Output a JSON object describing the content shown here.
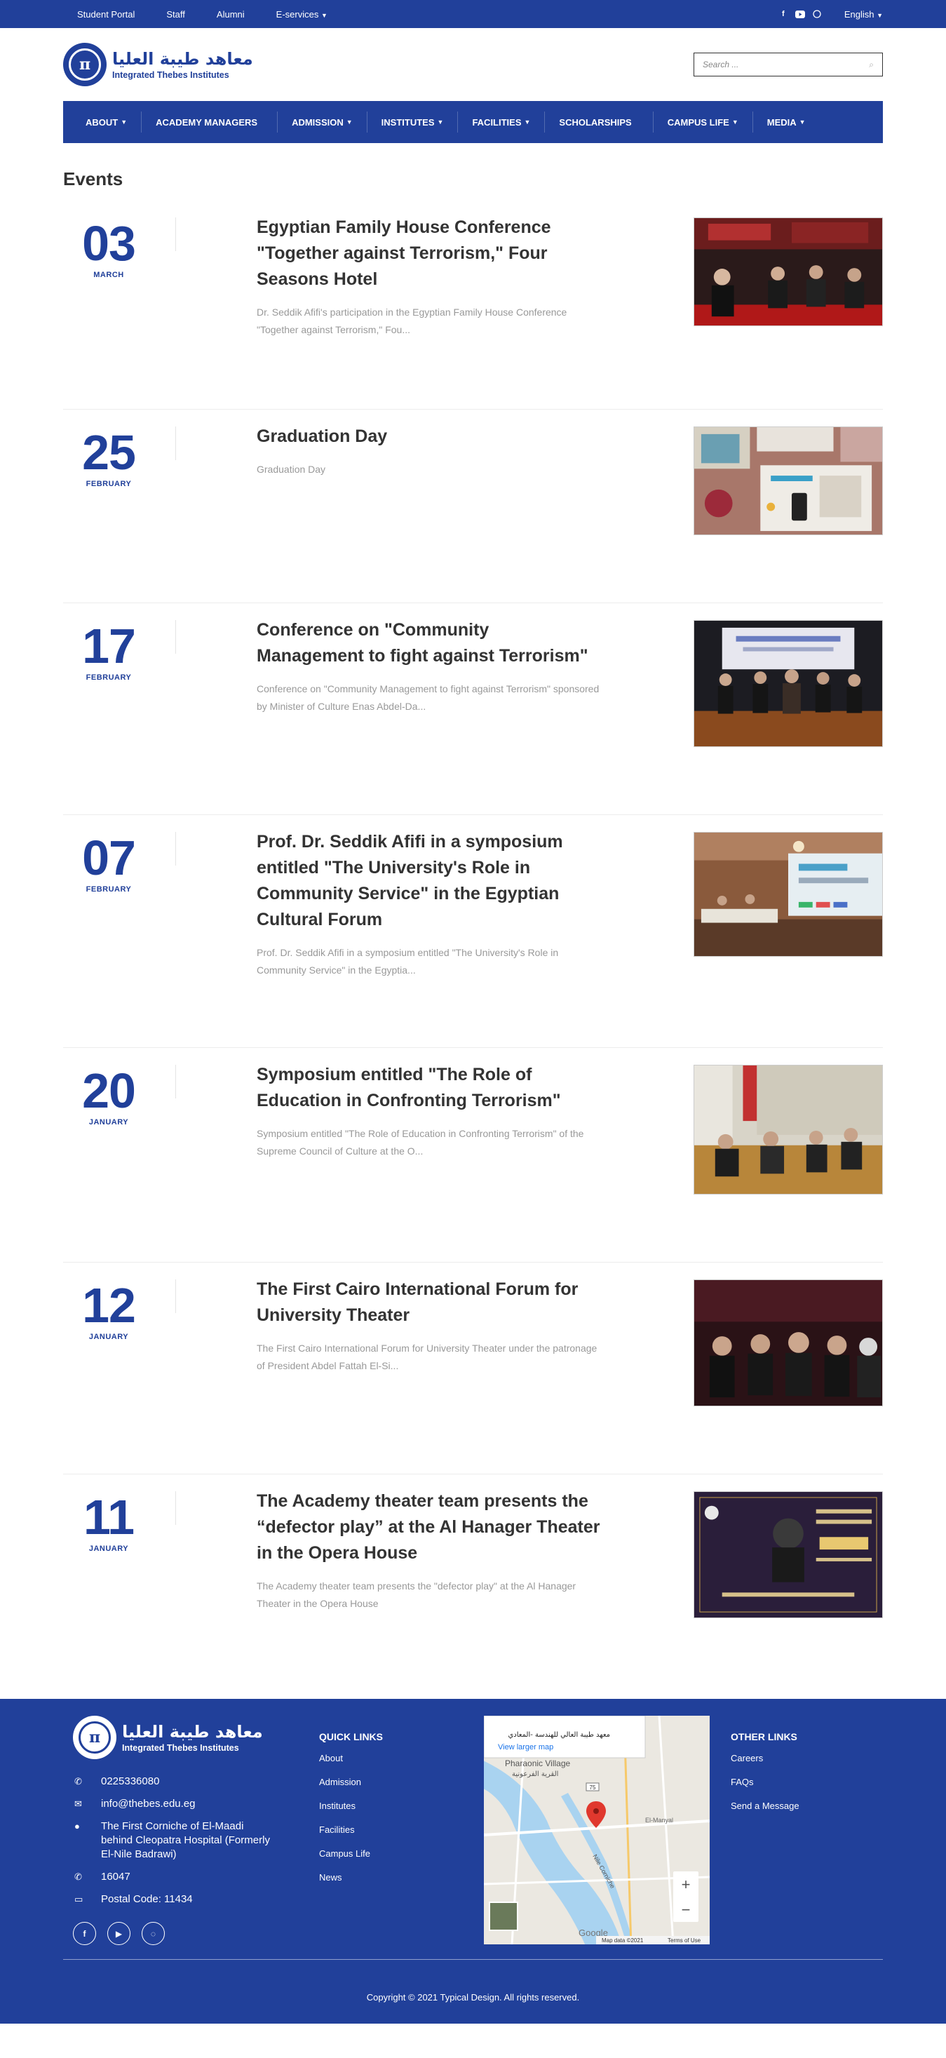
{
  "topbar": {
    "links": [
      "Student Portal",
      "Staff",
      "Alumni",
      "E-services"
    ],
    "language": "English",
    "social_icons": [
      "facebook-icon",
      "youtube-icon",
      "whatsapp-icon"
    ]
  },
  "brand": {
    "arabic_name": "معاهد طيبة العليا",
    "english_name": "Integrated Thebes Institutes"
  },
  "search": {
    "placeholder": "Search ..."
  },
  "nav": [
    "ABOUT",
    "ACADEMY MANAGERS",
    "ADMISSION",
    "INSTITUTES",
    "FACILITIES",
    "SCHOLARSHIPS",
    "CAMPUS LIFE",
    "MEDIA"
  ],
  "page_title": "Events",
  "events": [
    {
      "day": "03",
      "month": "MARCH",
      "title": "Egyptian Family House Conference \"Together against Terrorism,\" Four Seasons Hotel",
      "description": "Dr. Seddik Afifi's participation in the Egyptian Family House Conference \"Together against Terrorism,\" Fou..."
    },
    {
      "day": "25",
      "month": "FEBRUARY",
      "title": "Graduation Day",
      "description": "Graduation Day"
    },
    {
      "day": "17",
      "month": "FEBRUARY",
      "title": "Conference on \"Community Management to fight against Terrorism\"",
      "description": "Conference on \"Community Management to fight against Terrorism\" sponsored by Minister of Culture Enas Abdel-Da..."
    },
    {
      "day": "07",
      "month": "FEBRUARY",
      "title": "Prof. Dr. Seddik Afifi in a symposium entitled \"The University's Role in Community Service\" in the Egyptian Cultural Forum",
      "description": "Prof. Dr. Seddik Afifi in a symposium entitled \"The University's Role in Community Service\" in the Egyptia..."
    },
    {
      "day": "20",
      "month": "JANUARY",
      "title": "Symposium entitled \"The Role of Education in Confronting Terrorism\"",
      "description": "Symposium entitled \"The Role of Education in Confronting Terrorism\" of the Supreme Council of Culture at the O..."
    },
    {
      "day": "12",
      "month": "JANUARY",
      "title": "The First Cairo International Forum for University Theater",
      "description": "The First Cairo International Forum for University Theater under the patronage of President Abdel Fattah El-Si..."
    },
    {
      "day": "11",
      "month": "JANUARY",
      "title": "The Academy theater team presents the “defector play” at the Al Hanager Theater in the Opera House",
      "description": "The Academy theater team presents the \"defector play\" at the Al Hanager Theater in the Opera House"
    }
  ],
  "footer": {
    "phone": "0225336080",
    "email": "info@thebes.edu.eg",
    "address": "The First Corniche of El-Maadi behind Cleopatra Hospital (Formerly El-Nile Badrawi)",
    "hotline": "16047",
    "postal": "Postal Code: 11434",
    "quick_links_title": "QUICK LINKS",
    "quick_links": [
      "About",
      "Admission",
      "Institutes",
      "Facilities",
      "Campus Life",
      "News"
    ],
    "other_links_title": "OTHER LINKS",
    "other_links": [
      "Careers",
      "FAQs",
      "Send a Message"
    ],
    "map": {
      "place_name": "معهد طيبة العالي للهندسة -المعادي",
      "view_larger": "View larger map",
      "label_village": "Pharaonic Village",
      "label_village_ar": "القرية الفرعونية",
      "label_corniche": "Nile Corniche",
      "label_elmanyal": "El-Manyal",
      "label_google": "Google",
      "attribution": "Map data ©2021",
      "terms": "Terms of Use",
      "road_number": "75",
      "zoom_in": "+",
      "zoom_out": "−"
    },
    "copyright": "Copyright © 2021 Typical Design. All rights reserved."
  }
}
